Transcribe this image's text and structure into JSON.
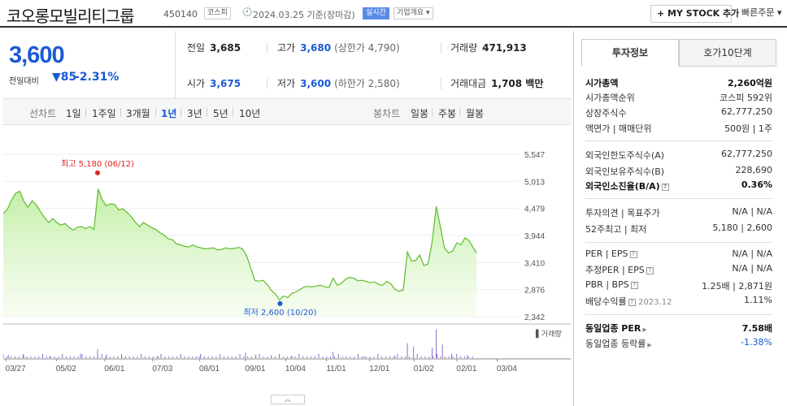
{
  "header": {
    "company_name": "코오롱모빌리티그룹",
    "code": "450140",
    "market_tag": "코스피",
    "base_date": "2024.03.25 기준(장마감)",
    "realtime_tag": "실시간",
    "overview_tag": "기업개요 ▾",
    "mystock_button": "+ MY STOCK 추가",
    "quick_order": "빠른주문 ▾"
  },
  "price": {
    "current": "3,600",
    "diff_label": "전일대비",
    "diff_value": "▼85",
    "diff_percent": "-2.31%"
  },
  "stats": {
    "prev_close": {
      "label": "전일",
      "value": "3,685"
    },
    "high": {
      "label": "고가",
      "value": "3,680",
      "sub": "(상한가 4,790)"
    },
    "volume": {
      "label": "거래량",
      "value": "471,913"
    },
    "open": {
      "label": "시가",
      "value": "3,675"
    },
    "low": {
      "label": "저가",
      "value": "3,600",
      "sub": "(하한가 2,580)"
    },
    "trade_value": {
      "label": "거래대금",
      "value": "1,708 백만"
    }
  },
  "period_bar": {
    "line_label": "선차트",
    "periods": [
      "1일",
      "1주일",
      "3개월",
      "1년",
      "3년",
      "5년",
      "10년"
    ],
    "active": "1년",
    "candle_label": "봉차트",
    "candles": [
      "일봉",
      "주봉",
      "월봉"
    ]
  },
  "chart_data": {
    "type": "area",
    "y_ticks": [
      "5,547",
      "5,013",
      "4,479",
      "3,944",
      "3,410",
      "2,876",
      "2,342"
    ],
    "ylim": [
      2342,
      5547
    ],
    "x_ticks": [
      "03/27",
      "05/02",
      "06/01",
      "07/03",
      "08/01",
      "09/01",
      "10/04",
      "11/01",
      "12/01",
      "01/02",
      "02/01",
      "03/04"
    ],
    "max_annotation": "최고 5,180 (06/12)",
    "min_annotation": "최저 2,600 (10/20)",
    "volume_label": "거래량",
    "max_point": {
      "x": 0.183,
      "y": 5180
    },
    "min_point": {
      "x": 0.537,
      "y": 2600
    },
    "fill_color": "#bfeea0",
    "line_color": "#5dbb2e",
    "series": [
      [
        0.0,
        4380
      ],
      [
        0.008,
        4460
      ],
      [
        0.016,
        4640
      ],
      [
        0.024,
        4780
      ],
      [
        0.032,
        4820
      ],
      [
        0.04,
        4620
      ],
      [
        0.048,
        4500
      ],
      [
        0.056,
        4630
      ],
      [
        0.064,
        4550
      ],
      [
        0.072,
        4420
      ],
      [
        0.08,
        4300
      ],
      [
        0.088,
        4200
      ],
      [
        0.096,
        4280
      ],
      [
        0.104,
        4200
      ],
      [
        0.112,
        4150
      ],
      [
        0.12,
        4180
      ],
      [
        0.128,
        4100
      ],
      [
        0.136,
        4050
      ],
      [
        0.144,
        4110
      ],
      [
        0.152,
        4120
      ],
      [
        0.16,
        4080
      ],
      [
        0.168,
        4120
      ],
      [
        0.176,
        4060
      ],
      [
        0.184,
        4860
      ],
      [
        0.192,
        4650
      ],
      [
        0.2,
        4530
      ],
      [
        0.208,
        4570
      ],
      [
        0.216,
        4560
      ],
      [
        0.224,
        4450
      ],
      [
        0.232,
        4470
      ],
      [
        0.24,
        4400
      ],
      [
        0.248,
        4320
      ],
      [
        0.256,
        4210
      ],
      [
        0.264,
        4120
      ],
      [
        0.272,
        4200
      ],
      [
        0.28,
        4150
      ],
      [
        0.288,
        4100
      ],
      [
        0.296,
        4060
      ],
      [
        0.304,
        4000
      ],
      [
        0.312,
        3950
      ],
      [
        0.32,
        3880
      ],
      [
        0.328,
        3860
      ],
      [
        0.336,
        3780
      ],
      [
        0.344,
        3760
      ],
      [
        0.352,
        3730
      ],
      [
        0.36,
        3720
      ],
      [
        0.368,
        3760
      ],
      [
        0.376,
        3720
      ],
      [
        0.384,
        3700
      ],
      [
        0.392,
        3680
      ],
      [
        0.4,
        3690
      ],
      [
        0.408,
        3700
      ],
      [
        0.416,
        3660
      ],
      [
        0.424,
        3670
      ],
      [
        0.432,
        3700
      ],
      [
        0.44,
        3680
      ],
      [
        0.448,
        3690
      ],
      [
        0.456,
        3710
      ],
      [
        0.464,
        3680
      ],
      [
        0.472,
        3550
      ],
      [
        0.48,
        3310
      ],
      [
        0.488,
        3060
      ],
      [
        0.496,
        3040
      ],
      [
        0.504,
        3060
      ],
      [
        0.512,
        2980
      ],
      [
        0.52,
        2860
      ],
      [
        0.528,
        2790
      ],
      [
        0.536,
        2670
      ],
      [
        0.544,
        2750
      ],
      [
        0.552,
        2720
      ],
      [
        0.56,
        2800
      ],
      [
        0.568,
        2830
      ],
      [
        0.576,
        2880
      ],
      [
        0.584,
        2930
      ],
      [
        0.592,
        2940
      ],
      [
        0.6,
        2930
      ],
      [
        0.608,
        2950
      ],
      [
        0.616,
        2960
      ],
      [
        0.624,
        2930
      ],
      [
        0.632,
        2920
      ],
      [
        0.64,
        3100
      ],
      [
        0.648,
        2960
      ],
      [
        0.656,
        3000
      ],
      [
        0.664,
        3080
      ],
      [
        0.672,
        3120
      ],
      [
        0.68,
        3100
      ],
      [
        0.688,
        3050
      ],
      [
        0.696,
        3060
      ],
      [
        0.704,
        3040
      ],
      [
        0.712,
        3010
      ],
      [
        0.72,
        3030
      ],
      [
        0.728,
        2980
      ],
      [
        0.736,
        2960
      ],
      [
        0.744,
        3040
      ],
      [
        0.752,
        2990
      ],
      [
        0.76,
        2880
      ],
      [
        0.768,
        2840
      ],
      [
        0.776,
        2870
      ],
      [
        0.784,
        3620
      ],
      [
        0.792,
        3440
      ],
      [
        0.8,
        3450
      ],
      [
        0.808,
        3560
      ],
      [
        0.816,
        3350
      ],
      [
        0.824,
        3380
      ],
      [
        0.832,
        3820
      ],
      [
        0.84,
        4520
      ],
      [
        0.848,
        4120
      ],
      [
        0.856,
        3700
      ],
      [
        0.864,
        3600
      ],
      [
        0.872,
        3640
      ],
      [
        0.88,
        3800
      ],
      [
        0.888,
        3760
      ],
      [
        0.896,
        3900
      ],
      [
        0.904,
        3840
      ],
      [
        0.912,
        3700
      ],
      [
        0.918,
        3600
      ]
    ],
    "volume_bars": [
      [
        0.01,
        0.1
      ],
      [
        0.04,
        0.08
      ],
      [
        0.09,
        0.06
      ],
      [
        0.15,
        0.15
      ],
      [
        0.183,
        0.3
      ],
      [
        0.2,
        0.12
      ],
      [
        0.23,
        0.08
      ],
      [
        0.3,
        0.06
      ],
      [
        0.38,
        0.05
      ],
      [
        0.47,
        0.18
      ],
      [
        0.49,
        0.12
      ],
      [
        0.52,
        0.1
      ],
      [
        0.56,
        0.07
      ],
      [
        0.64,
        0.2
      ],
      [
        0.7,
        0.06
      ],
      [
        0.76,
        0.08
      ],
      [
        0.784,
        0.5
      ],
      [
        0.796,
        0.38
      ],
      [
        0.832,
        0.35
      ],
      [
        0.84,
        0.95
      ],
      [
        0.852,
        0.45
      ],
      [
        0.87,
        0.15
      ],
      [
        0.9,
        0.1
      ]
    ]
  },
  "right_tabs": [
    "투자정보",
    "호가10단계"
  ],
  "info": {
    "market_cap": {
      "label": "시가총액",
      "value": "2,260억원"
    },
    "market_cap_rank": {
      "label": "시가총액순위",
      "value": "코스피 592위"
    },
    "shares": {
      "label": "상장주식수",
      "value": "62,777,250"
    },
    "face_value": {
      "label": "액면가 | 매매단위",
      "value": "500원 | 1주"
    },
    "foreign_limit": {
      "label": "외국인한도주식수(A)",
      "value": "62,777,250"
    },
    "foreign_hold": {
      "label": "외국인보유주식수(B)",
      "value": "228,690"
    },
    "foreign_ratio": {
      "label": "외국인소진율(B/A)",
      "value": "0.36%"
    },
    "opinion": {
      "label": "투자의견 | 목표주가",
      "value": "N/A | N/A"
    },
    "week52": {
      "label": "52주최고 | 최저",
      "value": "5,180 | 2,600"
    },
    "per_eps": {
      "label": "PER | EPS",
      "value": "N/A | N/A"
    },
    "est_per_eps": {
      "label": "추정PER | EPS",
      "value": "N/A | N/A"
    },
    "pbr_bps": {
      "label": "PBR | BPS",
      "value": "1.25배 | 2,871원"
    },
    "dividend": {
      "label": "배당수익률",
      "date": "2023.12",
      "value": "1.11%"
    },
    "industry_per": {
      "label": "동일업종 PER",
      "value": "7.58배"
    },
    "industry_rate": {
      "label": "동일업종 등락률",
      "value": "-1.38%"
    }
  },
  "bottom_button": "︿"
}
